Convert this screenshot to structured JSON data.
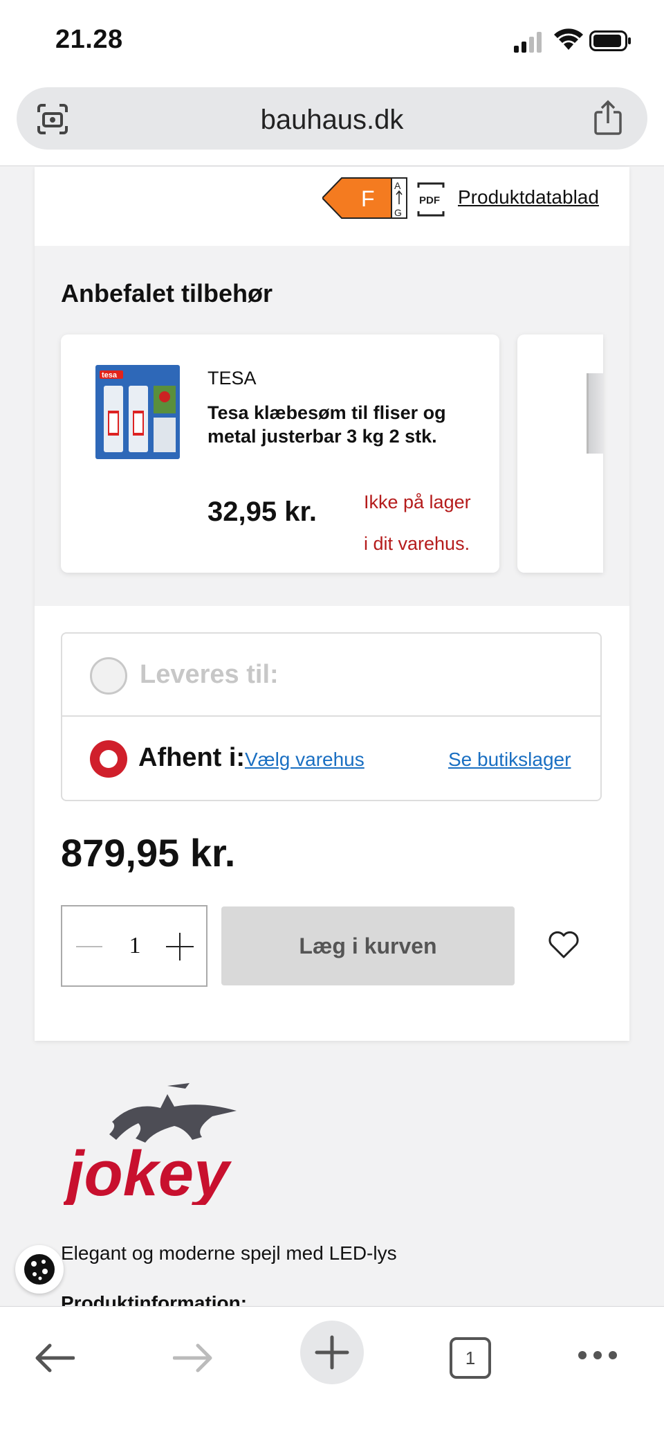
{
  "status_bar": {
    "time": "21.28"
  },
  "browser": {
    "url": "bauhaus.dk",
    "tab_count": "1"
  },
  "product": {
    "energy_class": "F",
    "energy_scale_top": "A",
    "energy_scale_bottom": "G",
    "pdf_label": "PDF",
    "datablad_link": "Produktdatablad",
    "price": "879,95 kr.",
    "quantity": "1",
    "add_to_cart": "Læg i kurven"
  },
  "accessories": {
    "title": "Anbefalet tilbehør",
    "items": [
      {
        "brand": "TESA",
        "name": "Tesa klæbesøm til fliser og metal justerbar 3 kg 2 stk.",
        "price": "32,95 kr.",
        "stock_line1": "Ikke på lager",
        "stock_line2": "i dit varehus."
      }
    ]
  },
  "delivery": {
    "option_deliver": "Leveres til:",
    "option_pickup": "Afhent i:",
    "choose_store_link": "Vælg varehus",
    "store_stock_link": "Se butikslager"
  },
  "brand_section": {
    "logo_text": "jokey",
    "description": "Elegant og moderne spejl med LED-lys",
    "product_info_heading": "Produktinformation:"
  },
  "colors": {
    "accent_red": "#d01f2b",
    "link_blue": "#1a6fc2",
    "energy_orange": "#f47b20"
  }
}
